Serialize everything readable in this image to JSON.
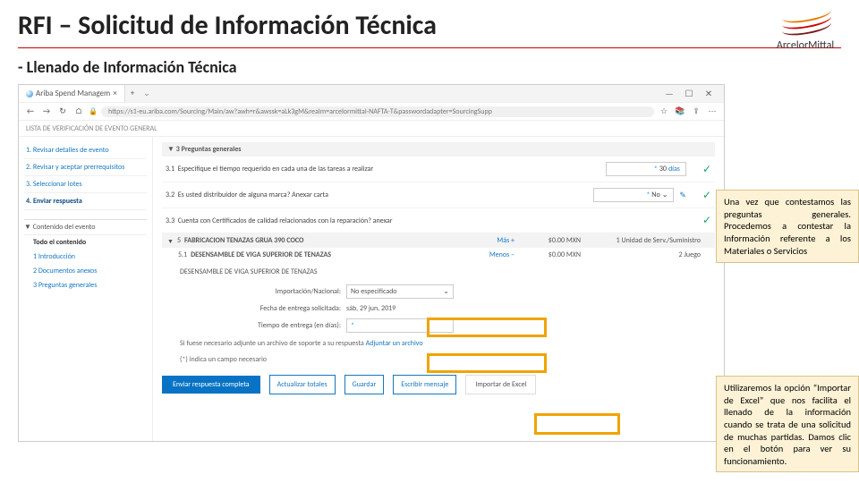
{
  "header": {
    "title": "RFI – Solicitud de Información Técnica",
    "subtitle_prefix": "- ",
    "subtitle": "Llenado de Información Técnica"
  },
  "logo": {
    "text": "ArcelorMittal"
  },
  "browser": {
    "tab_label": "Ariba Spend Managem",
    "url": "https://s1-eu.ariba.com/Sourcing/Main/aw?awh=r&awssk=aLk3gM&realm=arcelormittal-NAFTA-T&passwordadapter=SourcingSupp",
    "win": {
      "min": "—",
      "max": "☐",
      "close": "✕"
    },
    "nav": {
      "back": "←",
      "fwd": "→",
      "reload": "↻",
      "home": "⌂"
    },
    "top_line": "LISTA DE VERIFICACIÓN DE EVENTO GENERAL"
  },
  "sidebar": {
    "steps": [
      "1. Revisar detalles de evento",
      "2. Revisar y aceptar prerrequisitos",
      "3. Seleccionar lotes",
      "4. Enviar respuesta"
    ],
    "content_title": "▼ Contenido del evento",
    "subs": [
      "Todo el contenido",
      "1  Introducción",
      "2  Documentos anexos",
      "3  Preguntas generales"
    ]
  },
  "questions": {
    "group": "▼ 3  Preguntas generales",
    "q31": {
      "num": "3.1",
      "text": "Especifique el tiempo requerido en cada una de las tareas a realizar",
      "value": "30",
      "unit": "días"
    },
    "q32": {
      "num": "3.2",
      "text": "Es usted distribuidor de alguna marca? Anexar carta",
      "value": "No",
      "chev": "⌄"
    },
    "q33": {
      "num": "3.3",
      "text": "Cuenta con Certificados de calidad relacionados con la reparación? anexar"
    }
  },
  "items": {
    "row5": {
      "caret": "▼",
      "num": "5",
      "name": "FABRICACION TENAZAS GRUA 390 COCO",
      "mas": "Más +",
      "amt": "$0.00 MXN",
      "units": "1 Unidad de Serv./Suministro"
    },
    "row51": {
      "num": "5.1",
      "name": "DESENSAMBLE DE VIGA SUPERIOR DE TENAZAS",
      "menos": "Menos –",
      "amt": "$0.00 MXN",
      "units": "2 Juego"
    },
    "sub_label": "DESENSAMBLE DE VIGA SUPERIOR DE TENAZAS",
    "detail": {
      "impnac_label": "Importación/Nacional:",
      "impnac_value": "No especificado",
      "fecha_label": "Fecha de entrega solicitada:",
      "fecha_value": "sáb, 29 jun, 2019",
      "tiempo_label": "Tiempo de entrega (en días):",
      "tiempo_star": "*",
      "note": "Si fuese necesario adjunte un archivo de soporte a su respuesta  ",
      "note_link": "Adjuntar un archivo",
      "req": "(*) indica un campo necesario"
    }
  },
  "buttons": {
    "submit": "Enviar respuesta completa",
    "actualizar": "Actualizar totales",
    "guardar": "Guardar",
    "mensaje": "Escribir mensaje",
    "excel": "Importar de Excel"
  },
  "callouts": {
    "top": "Una vez que contestamos las preguntas generales. Procedemos a contestar la Información referente a los Materiales o Servicios",
    "bottom": "Utilizaremos la opción “Importar de Excel” que nos facilita el llenado de la información cuando se trata de una solicitud de muchas partidas. Damos clic en el botón para ver su funcionamiento."
  }
}
